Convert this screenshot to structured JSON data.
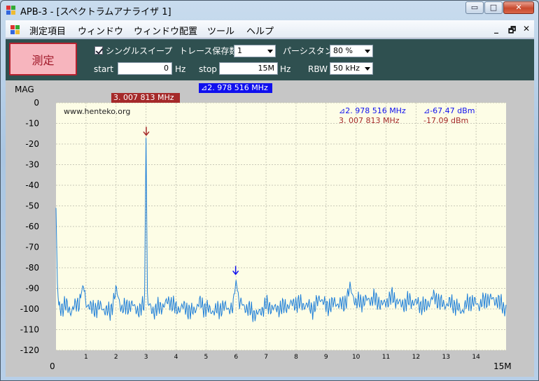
{
  "window": {
    "title": "APB-3 - [スペクトラムアナライザ 1]",
    "buttons": {
      "minimize": "▭",
      "maximize": "□",
      "close": "✕"
    }
  },
  "menu": {
    "items": [
      "測定項目",
      "ウィンドウ",
      "ウィンドウ配置",
      "ツール",
      "ヘルプ"
    ],
    "mdi": {
      "minimize": "_",
      "restore": "🗗",
      "close": "✕"
    }
  },
  "toolbar": {
    "measure_label": "測定",
    "single_sweep": {
      "label": "シングルスイープ",
      "checked": true
    },
    "trace_hold": {
      "label": "トレース保存数",
      "value": "1"
    },
    "persistence": {
      "label": "パーシスタンス",
      "value": "80 %"
    },
    "start": {
      "label": "start",
      "value": "0",
      "unit": "Hz"
    },
    "stop": {
      "label": "stop",
      "value": "15M",
      "unit": "Hz"
    },
    "rbw": {
      "label": "RBW",
      "value": "50 kHz"
    }
  },
  "colors": {
    "marker1": "#a52a2a",
    "marker2": "#1010ee",
    "trace": "#1f7fd8",
    "plot_bg": "#fdfde6",
    "toolbar_bg": "#2f5050"
  },
  "chart": {
    "ylabel": "MAG",
    "x_start_label": "0",
    "x_end_label": "15M",
    "watermark": "www.henteko.org",
    "marker1_box": "3. 007 813 MHz",
    "marker2_box": "⊿2. 978 516 MHz",
    "readout": {
      "delta_freq": "⊿2. 978 516 MHz",
      "delta_level": "⊿-67.47 dBm",
      "m1_freq": "3. 007 813 MHz",
      "m1_level": "-17.09 dBm"
    }
  },
  "chart_data": {
    "type": "line",
    "ylabel": "MAG",
    "ylim": [
      -120,
      0
    ],
    "xlim": [
      0,
      15
    ],
    "y_ticks": [
      0,
      -10,
      -20,
      -30,
      -40,
      -50,
      -60,
      -70,
      -80,
      -90,
      -100,
      -110,
      -120
    ],
    "x_ticks": [
      1,
      2,
      3,
      4,
      5,
      6,
      7,
      8,
      9,
      10,
      11,
      12,
      13,
      14
    ],
    "grid": true,
    "series": [
      {
        "x": [
          0,
          0.05,
          0.1,
          0.3,
          0.5,
          0.8,
          0.9,
          1.0,
          1.2,
          1.5,
          1.8,
          2.0,
          2.2,
          2.5,
          2.8,
          2.95,
          3.0,
          3.05,
          3.2,
          3.5,
          3.8,
          4.0,
          4.3,
          4.5,
          4.8,
          5.0,
          5.3,
          5.6,
          5.9,
          6.0,
          6.1,
          6.4,
          6.7,
          7.0,
          7.3,
          7.6,
          8.0,
          8.3,
          8.6,
          8.8,
          9.0,
          9.3,
          9.6,
          9.8,
          10.0,
          10.3,
          10.6,
          10.9,
          11.2,
          11.5,
          11.8,
          12.0,
          12.3,
          12.6,
          12.9,
          13.2,
          13.5,
          13.8,
          14.1,
          14.4,
          14.7,
          15.0
        ],
        "y": [
          -51,
          -90,
          -100,
          -98,
          -101,
          -96,
          -88,
          -97,
          -100,
          -99,
          -102,
          -91,
          -100,
          -98,
          -101,
          -97,
          -17,
          -97,
          -101,
          -99,
          -96,
          -100,
          -99,
          -102,
          -97,
          -100,
          -101,
          -99,
          -100,
          -86,
          -97,
          -100,
          -103,
          -98,
          -100,
          -99,
          -97,
          -98,
          -100,
          -94,
          -99,
          -97,
          -98,
          -90,
          -97,
          -96,
          -95,
          -98,
          -94,
          -98,
          -96,
          -97,
          -99,
          -94,
          -98,
          -97,
          -101,
          -96,
          -98,
          -95,
          -96,
          -100
        ]
      }
    ],
    "markers": [
      {
        "x": 3.007813,
        "y": -17.09
      },
      {
        "x": 5.986329,
        "y": -84.56
      }
    ]
  }
}
